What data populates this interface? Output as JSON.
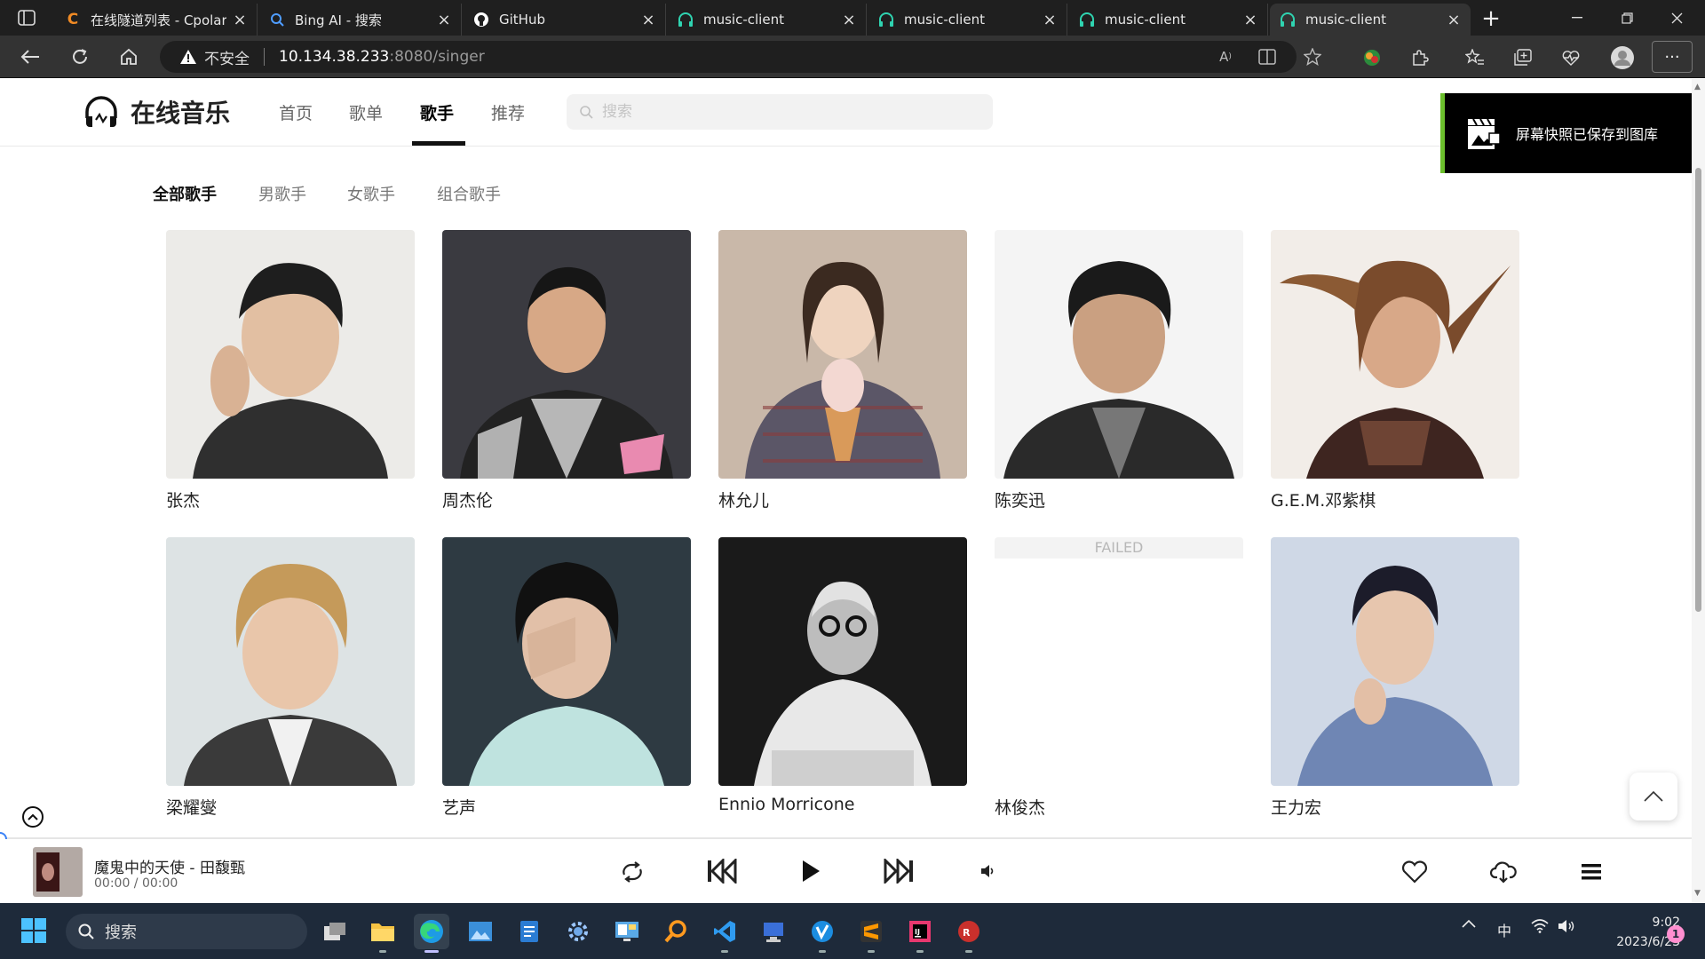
{
  "browser": {
    "tabs": [
      {
        "title": "在线隧道列表 - Cpolar",
        "icon": "cpolar-icon",
        "active": false
      },
      {
        "title": "Bing AI - 搜索",
        "icon": "bing-search-icon",
        "active": false
      },
      {
        "title": "GitHub",
        "icon": "github-icon",
        "active": false
      },
      {
        "title": "music-client",
        "icon": "headphones-icon",
        "active": false
      },
      {
        "title": "music-client",
        "icon": "headphones-icon",
        "active": false
      },
      {
        "title": "music-client",
        "icon": "headphones-icon",
        "active": false
      },
      {
        "title": "music-client",
        "icon": "headphones-icon",
        "active": true
      }
    ],
    "security_label": "不安全",
    "url_host": "10.134.38.233",
    "url_path": ":8080/singer"
  },
  "site": {
    "title": "在线音乐",
    "nav": [
      "首页",
      "歌单",
      "歌手",
      "推荐"
    ],
    "active_nav": "歌手",
    "search_placeholder": "搜索"
  },
  "toast": {
    "text": "屏幕快照已保存到图库"
  },
  "filters": [
    "全部歌手",
    "男歌手",
    "女歌手",
    "组合歌手"
  ],
  "singers": [
    {
      "name": "张杰"
    },
    {
      "name": "周杰伦"
    },
    {
      "name": "林允儿"
    },
    {
      "name": "陈奕迅"
    },
    {
      "name": "G.E.M.邓紫棋"
    },
    {
      "name": "梁耀燮"
    },
    {
      "name": "艺声"
    },
    {
      "name": "Ennio Morricone"
    },
    {
      "name": "林俊杰",
      "image_status": "FAILED"
    },
    {
      "name": "王力宏"
    }
  ],
  "player": {
    "song": "魔鬼中的天使 - 田馥甄",
    "time": "00:00 / 00:00"
  },
  "taskbar": {
    "search_label": "搜索",
    "ime": "中",
    "time": "9:02",
    "date": "2023/6/23",
    "notifications": "1"
  },
  "colors": {
    "chrome_bg": "#1f1f1f",
    "toast_accent": "#6bbf2c",
    "taskbar_bg": "#1e2a3a"
  }
}
